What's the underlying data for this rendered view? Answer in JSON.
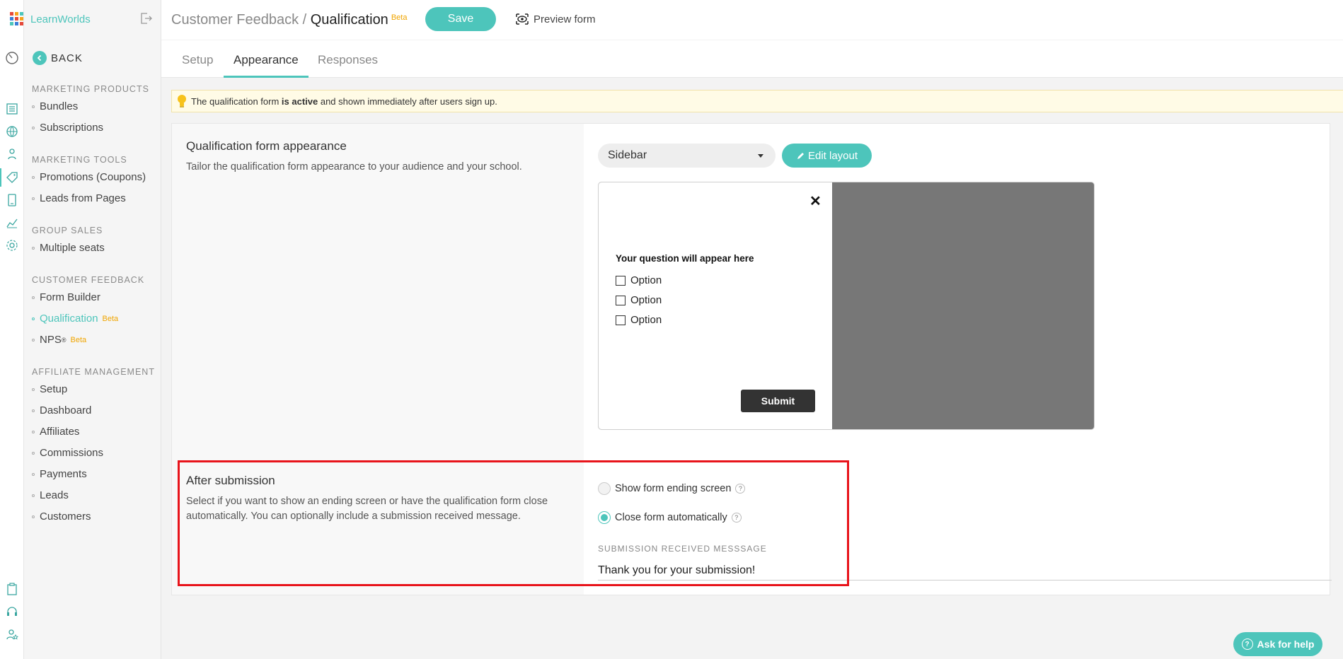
{
  "brand": {
    "name": "LearnWorlds"
  },
  "colors": {
    "accent": "#4dc5bb",
    "beta": "#f0a500",
    "highlight": "#e8141b"
  },
  "header": {
    "crumb_parent": "Customer Feedback / ",
    "crumb_current": "Qualification",
    "beta": "Beta",
    "save_label": "Save",
    "preview_label": "Preview form"
  },
  "tabs": [
    {
      "label": "Setup"
    },
    {
      "label": "Appearance"
    },
    {
      "label": "Responses"
    }
  ],
  "sidebar": {
    "back_label": "BACK",
    "sections": [
      {
        "title": "MARKETING PRODUCTS",
        "items": [
          "Bundles",
          "Subscriptions"
        ]
      },
      {
        "title": "MARKETING TOOLS",
        "items": [
          "Promotions (Coupons)",
          "Leads from Pages"
        ]
      },
      {
        "title": "GROUP SALES",
        "items": [
          "Multiple seats"
        ]
      },
      {
        "title": "CUSTOMER FEEDBACK",
        "items": [
          "Form Builder",
          "Qualification",
          "NPS"
        ]
      },
      {
        "title": "AFFILIATE MANAGEMENT",
        "items": [
          "Setup",
          "Dashboard",
          "Affiliates",
          "Commissions",
          "Payments",
          "Leads",
          "Customers"
        ]
      }
    ],
    "nps_sup": "®",
    "beta": "Beta",
    "active_item": "Qualification"
  },
  "info": {
    "prefix": "The qualification form ",
    "bold": "is active",
    "suffix": " and shown immediately after users sign up."
  },
  "appearance": {
    "title": "Qualification form appearance",
    "description": "Tailor the qualification form appearance to your audience and your school.",
    "layout_select": "Sidebar",
    "edit_layout_label": "Edit layout",
    "preview": {
      "question": "Your question will appear here",
      "options": [
        "Option",
        "Option",
        "Option"
      ],
      "submit_label": "Submit"
    }
  },
  "after_submission": {
    "title": "After submission",
    "description_line1": "Select if you want to show an ending screen or have the qualification form close",
    "description_line2": "automatically. You can optionally include a submission received message.",
    "options": [
      {
        "label": "Show form ending screen",
        "selected": false
      },
      {
        "label": "Close form automatically",
        "selected": true
      }
    ],
    "field_label": "SUBMISSION RECEIVED MESSSAGE",
    "field_value": "Thank you for your submission!"
  },
  "help_widget": {
    "label": "Ask for help"
  }
}
